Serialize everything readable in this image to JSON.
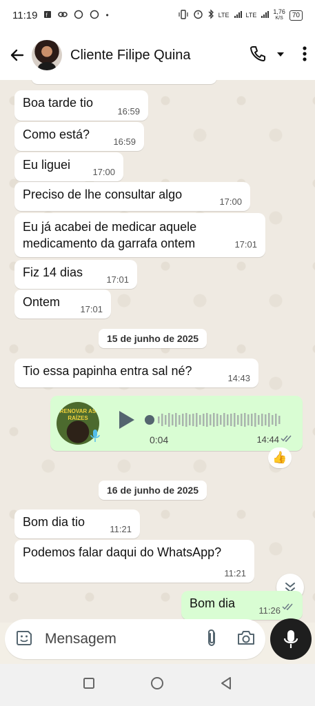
{
  "status_bar": {
    "time": "11:19",
    "speed_value": "1,76",
    "speed_unit": "K/S",
    "battery": "70",
    "network_left": "LTE",
    "network_right": "LTE"
  },
  "header": {
    "contact_name": "Cliente Filipe Quina"
  },
  "messages": [
    {
      "text": "Boa tarde tio",
      "time": "16:59"
    },
    {
      "text": "Como está?",
      "time": "16:59"
    },
    {
      "text": "Eu liguei",
      "time": "17:00"
    },
    {
      "text": "Preciso de lhe consultar algo",
      "time": "17:00"
    },
    {
      "text": "Eu já acabei de medicar aquele medicamento da garrafa ontem",
      "time": "17:01"
    },
    {
      "text": "Fiz 14 dias",
      "time": "17:01"
    },
    {
      "text": "Ontem",
      "time": "17:01"
    },
    {
      "text": "Tio essa papinha entra sal né?",
      "time": "14:43"
    },
    {
      "text": "Bom dia tio",
      "time": "11:21"
    },
    {
      "text": "Podemos falar daqui do WhatsApp?",
      "time": "11:21"
    },
    {
      "text": "Bom dia",
      "time": "11:26"
    }
  ],
  "date_separators": [
    "15 de junho de 2025",
    "16 de junho de 2025"
  ],
  "voice_message": {
    "avatar_text": "RENOVAR AS RAÍZES",
    "duration": "0:04",
    "time": "14:44"
  },
  "reaction": "👍",
  "input": {
    "placeholder": "Mensagem"
  },
  "colors": {
    "incoming_bubble": "#ffffff",
    "outgoing_bubble": "#d9fdd3",
    "chat_background": "#efeae2",
    "mic_button": "#1e1e1e"
  },
  "icons": [
    "back-arrow-icon",
    "phone-icon",
    "dropdown-icon",
    "more-vert-icon",
    "play-icon",
    "mic-icon",
    "double-check-icon",
    "thumbs-up-icon",
    "chevrons-down-icon",
    "sticker-icon",
    "attach-icon",
    "camera-icon",
    "square-icon",
    "circle-icon",
    "triangle-back-icon"
  ]
}
